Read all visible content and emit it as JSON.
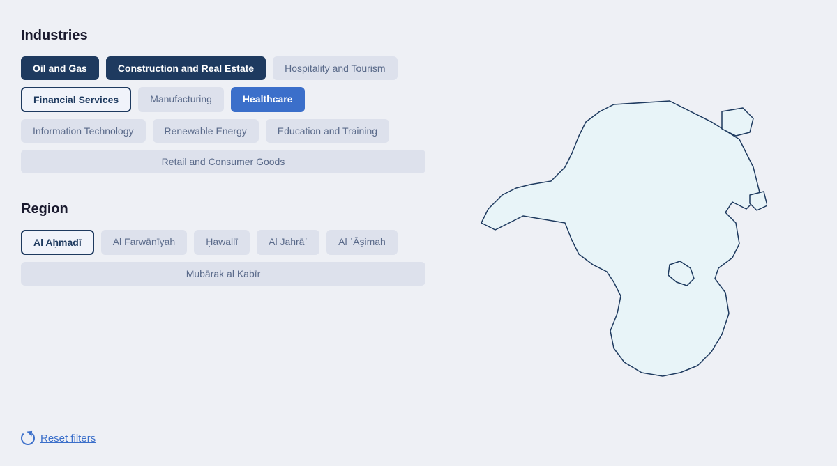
{
  "industries": {
    "title": "Industries",
    "tags": [
      {
        "id": "oil-gas",
        "label": "Oil and Gas",
        "state": "active-dark"
      },
      {
        "id": "construction",
        "label": "Construction and Real Estate",
        "state": "active-dark"
      },
      {
        "id": "hospitality",
        "label": "Hospitality and Tourism",
        "state": "default"
      },
      {
        "id": "financial",
        "label": "Financial Services",
        "state": "active-outline"
      },
      {
        "id": "manufacturing",
        "label": "Manufacturing",
        "state": "default"
      },
      {
        "id": "healthcare",
        "label": "Healthcare",
        "state": "active-blue-fill"
      },
      {
        "id": "it",
        "label": "Information Technology",
        "state": "default"
      },
      {
        "id": "renewable",
        "label": "Renewable Energy",
        "state": "default"
      },
      {
        "id": "education",
        "label": "Education and Training",
        "state": "default"
      },
      {
        "id": "retail",
        "label": "Retail and Consumer Goods",
        "state": "wide"
      }
    ]
  },
  "region": {
    "title": "Region",
    "tags": [
      {
        "id": "ahmadi",
        "label": "Al Aḥmadī",
        "state": "active-outline"
      },
      {
        "id": "farwaniyah",
        "label": "Al Farwānīyah",
        "state": "default"
      },
      {
        "id": "jahra",
        "label": "Ḥawallī",
        "state": "default"
      },
      {
        "id": "jahra2",
        "label": "Al Jahrāʾ",
        "state": "default"
      },
      {
        "id": "asimah",
        "label": "Al ʿĀṣimah",
        "state": "default"
      },
      {
        "id": "mubarak",
        "label": "Mubārak al Kabīr",
        "state": "wide"
      }
    ]
  },
  "reset": {
    "label": "Reset filters"
  }
}
